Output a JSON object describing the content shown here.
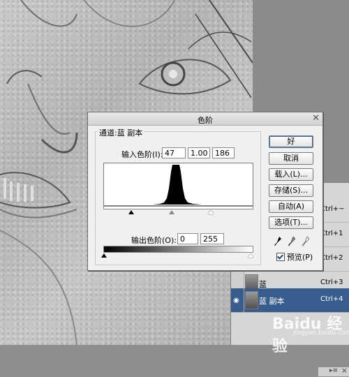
{
  "dialog": {
    "title": "色阶",
    "channel_label": "通道:蓝 副本",
    "input_label": "输入色阶(I):",
    "input_values": [
      "47",
      "1.00",
      "186"
    ],
    "output_label": "输出色阶(O):",
    "output_values": [
      "0",
      "255"
    ],
    "buttons": {
      "ok": "好",
      "cancel": "取消",
      "load": "载入(L)...",
      "save": "存储(S)...",
      "auto": "自动(A)",
      "options": "选项(T)..."
    },
    "preview_label": "预览(P)",
    "preview_checked": true
  },
  "layers": {
    "rows": [
      {
        "name": "",
        "shortcut": "Ctrl+~"
      },
      {
        "name": "",
        "shortcut": "Ctrl+1"
      },
      {
        "name": "",
        "shortcut": "Ctrl+2"
      },
      {
        "name": "蓝",
        "shortcut": "Ctrl+3"
      },
      {
        "name": "蓝 副本",
        "shortcut": "Ctrl+4"
      }
    ],
    "selected_color": "#375d8e"
  },
  "watermark": {
    "text": "Baidu 经验",
    "sub": "jingyan.baidu.com"
  },
  "icons": [
    "close-icon",
    "eyedropper-black-icon",
    "eyedropper-gray-icon",
    "eyedropper-white-icon",
    "eye-icon",
    "panel-menu-icon"
  ]
}
